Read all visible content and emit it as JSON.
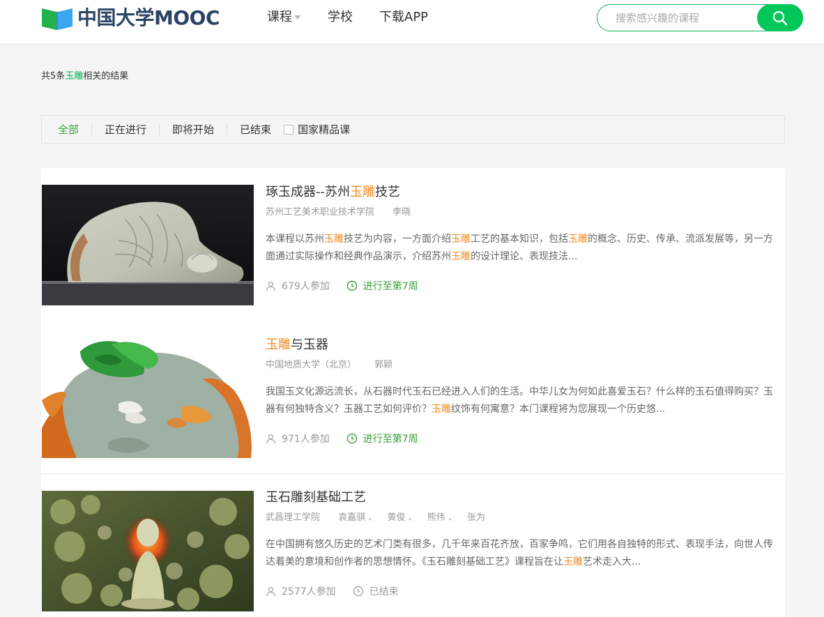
{
  "header": {
    "logo_text": "中国大学MOOC",
    "nav": [
      {
        "label": "课程",
        "has_caret": true
      },
      {
        "label": "学校"
      },
      {
        "label": "下载APP"
      }
    ],
    "search": {
      "placeholder": "搜索感兴趣的课程",
      "icon": "search-icon"
    }
  },
  "summary": {
    "prefix": "共5条",
    "keyword": "玉雕",
    "suffix": "相关的结果"
  },
  "filter": {
    "items": [
      "全部",
      "正在进行",
      "即将开始",
      "已结束"
    ],
    "active": "全部",
    "checkbox_label": "国家精品课"
  },
  "courses": [
    {
      "title": [
        {
          "t": "琢玉成器--苏州"
        },
        {
          "t": "玉雕",
          "hl": true
        },
        {
          "t": "技艺"
        }
      ],
      "school": "苏州工艺美术职业技术学院",
      "teachers": [
        "李晓"
      ],
      "description": [
        {
          "t": "本课程以苏州"
        },
        {
          "t": "玉雕",
          "hl": true
        },
        {
          "t": "技艺为内容，一方面介绍"
        },
        {
          "t": "玉雕",
          "hl": true
        },
        {
          "t": "工艺的基本知识，包括"
        },
        {
          "t": "玉雕",
          "hl": true
        },
        {
          "t": "的概念、历史、传承、流派发展等，另一方面通过实际操作和经典作品演示，介绍苏州"
        },
        {
          "t": "玉雕",
          "hl": true
        },
        {
          "t": "的设计理论、表现技法..."
        }
      ],
      "enrolled": "679人参加",
      "status": "进行至第7周",
      "status_active": true
    },
    {
      "title": [
        {
          "t": "玉雕",
          "hl": true
        },
        {
          "t": "与玉器"
        }
      ],
      "school": "中国地质大学（北京）",
      "teachers": [
        "郭颖"
      ],
      "description": [
        {
          "t": "我国玉文化源远流长，从石器时代玉石已经进入人们的生活。中华儿女为何如此喜爱玉石？什么样的玉石值得购买？玉器有何独特含义？玉器工艺如何评价？"
        },
        {
          "t": "玉雕",
          "hl": true
        },
        {
          "t": "纹饰有何寓意？本门课程将为您展现一个历史悠..."
        }
      ],
      "enrolled": "971人参加",
      "status": "进行至第7周",
      "status_active": true
    },
    {
      "title": [
        {
          "t": "玉石雕刻基础工艺"
        }
      ],
      "school": "武昌理工学院",
      "teachers": [
        "袁嘉骐",
        "黄俊",
        "熊伟",
        "张为"
      ],
      "description": [
        {
          "t": "在中国拥有悠久历史的艺术门类有很多，几千年来百花齐放，百家争鸣，它们用各自独特的形式、表现手法，向世人传达着美的意境和创作者的思想情怀。《玉石雕刻基础工艺》课程旨在让"
        },
        {
          "t": "玉雕",
          "hl": true
        },
        {
          "t": "艺术走入大..."
        }
      ],
      "enrolled": "2577人参加",
      "status": "已结束",
      "status_active": false
    }
  ],
  "colors": {
    "brand_green": "#00c759",
    "active_green": "#39a039",
    "highlight_orange": "#f08b1d",
    "logo_navy": "#2b4465"
  }
}
